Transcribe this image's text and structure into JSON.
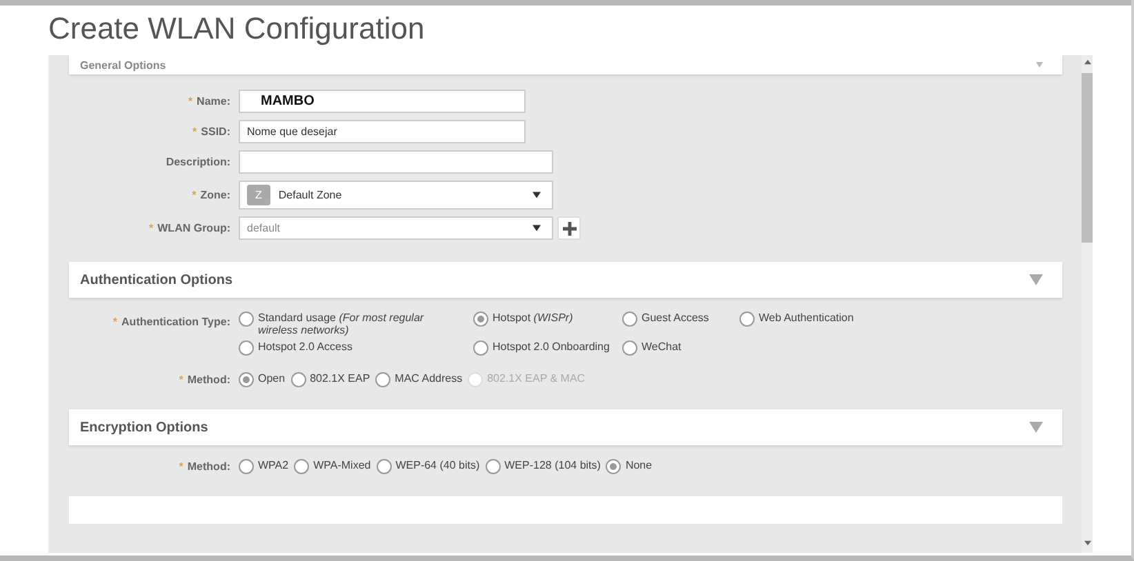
{
  "title": "Create WLAN Configuration",
  "general": {
    "title": "General Options",
    "fields": [
      {
        "kind": "text",
        "mark": "*",
        "label": "Name:",
        "value": "MAMBO",
        "bold": true
      },
      {
        "kind": "text",
        "mark": "*",
        "label": "SSID:",
        "value": "Nome que desejar",
        "bold": false
      },
      {
        "kind": "text",
        "label": "Description:"
      },
      {
        "kind": "select",
        "mark": "*",
        "label": "Zone:",
        "badge": "Z",
        "value": "Default Zone"
      },
      {
        "kind": "select-add",
        "mark": "*",
        "label": "WLAN Group:",
        "value": "default"
      }
    ]
  },
  "auth": {
    "title": "Authentication Options",
    "type": {
      "mark": "*",
      "label": "Authentication Type:",
      "options": [
        {
          "label": "Standard usage *(For most regular wireless networks)*",
          "selected": false,
          "disabled": false
        },
        {
          "label": "Hotspot *(WISPr)*",
          "selected": true,
          "disabled": false
        },
        {
          "label": "Guest Access",
          "selected": false,
          "disabled": false
        },
        {
          "label": "Web Authentication",
          "selected": false,
          "disabled": false
        },
        {
          "label": "Hotspot 2.0 Access",
          "selected": false,
          "disabled": false
        },
        {
          "label": "Hotspot 2.0 Onboarding",
          "selected": false,
          "disabled": false
        },
        {
          "label": "WeChat",
          "selected": false,
          "disabled": false
        }
      ]
    },
    "method": {
      "mark": "*",
      "label": "Method:",
      "options": [
        {
          "label": "Open",
          "selected": true,
          "disabled": false
        },
        {
          "label": "802.1X EAP",
          "selected": false,
          "disabled": false
        },
        {
          "label": "MAC Address",
          "selected": false,
          "disabled": false
        },
        {
          "label": "802.1X EAP & MAC",
          "selected": false,
          "disabled": true
        }
      ]
    }
  },
  "encryption": {
    "title": "Encryption Options",
    "method": {
      "mark": "*",
      "label": "Method:",
      "options": [
        {
          "label": "WPA2",
          "selected": false,
          "disabled": false
        },
        {
          "label": "WPA-Mixed",
          "selected": false,
          "disabled": false
        },
        {
          "label": "WEP-64 (40 bits)",
          "selected": false,
          "disabled": false
        },
        {
          "label": "WEP-128 (104 bits)",
          "selected": false,
          "disabled": false
        },
        {
          "label": "None",
          "selected": true,
          "disabled": false
        }
      ]
    }
  }
}
